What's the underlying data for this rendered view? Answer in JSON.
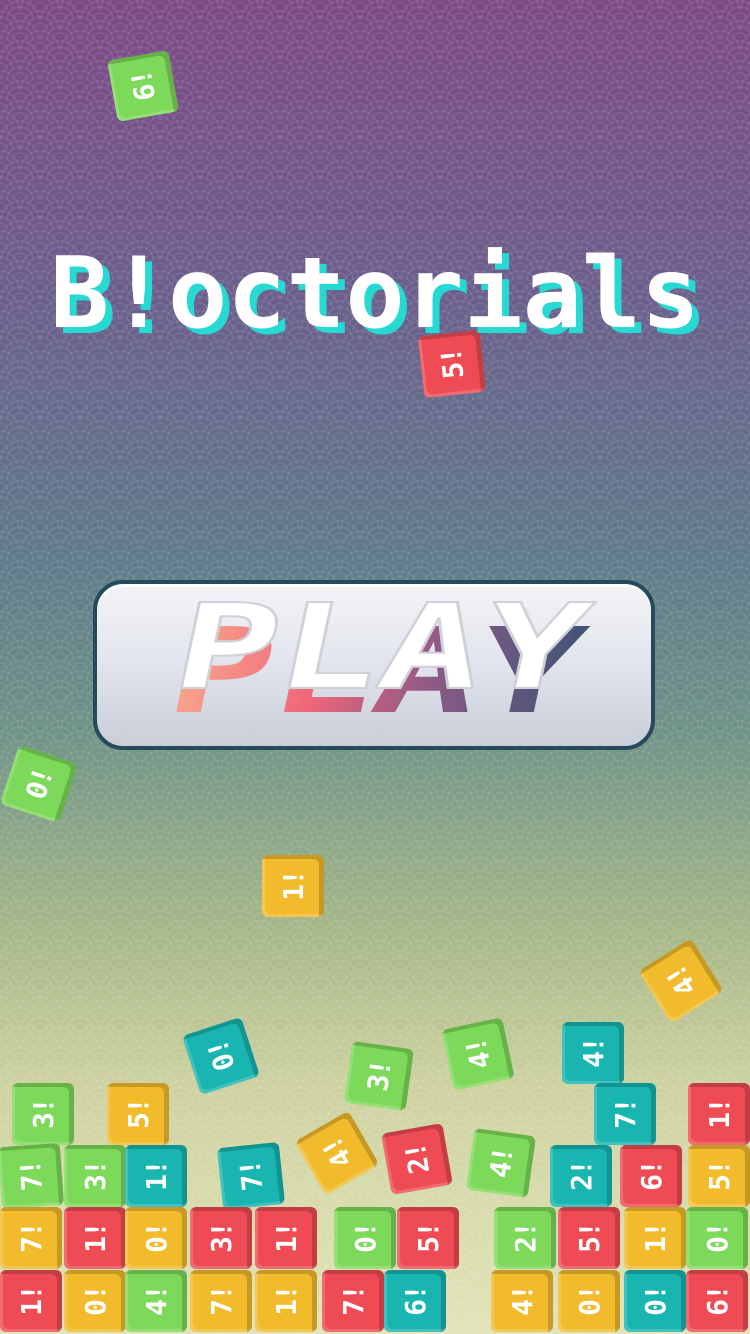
{
  "game": {
    "title": "B!octorials",
    "play_label": "PLAY"
  },
  "colors": {
    "green": "#7dd95a",
    "yellow": "#f1bb2c",
    "red": "#ee4b55",
    "teal": "#19b5b0",
    "title_fill": "#ffffff",
    "title_shadow": "#27d9d3",
    "button_border": "#244a5c"
  },
  "tiles": [
    {
      "label": "6!",
      "color": "green"
    },
    {
      "label": "5!",
      "color": "red"
    },
    {
      "label": "0!",
      "color": "green"
    },
    {
      "label": "1!",
      "color": "yellow"
    },
    {
      "label": "4!",
      "color": "yellow"
    },
    {
      "label": "0!",
      "color": "teal"
    },
    {
      "label": "3!",
      "color": "green"
    },
    {
      "label": "4!",
      "color": "green"
    },
    {
      "label": "4!",
      "color": "teal"
    },
    {
      "label": "3!",
      "color": "green"
    },
    {
      "label": "5!",
      "color": "yellow"
    },
    {
      "label": "7!",
      "color": "teal"
    },
    {
      "label": "1!",
      "color": "red"
    },
    {
      "label": "7!",
      "color": "green"
    },
    {
      "label": "3!",
      "color": "green"
    },
    {
      "label": "1!",
      "color": "teal"
    },
    {
      "label": "7!",
      "color": "teal"
    },
    {
      "label": "4!",
      "color": "yellow"
    },
    {
      "label": "2!",
      "color": "red"
    },
    {
      "label": "4!",
      "color": "green"
    },
    {
      "label": "2!",
      "color": "teal"
    },
    {
      "label": "6!",
      "color": "red"
    },
    {
      "label": "5!",
      "color": "yellow"
    },
    {
      "label": "7!",
      "color": "yellow"
    },
    {
      "label": "1!",
      "color": "red"
    },
    {
      "label": "0!",
      "color": "yellow"
    },
    {
      "label": "3!",
      "color": "red"
    },
    {
      "label": "1!",
      "color": "red"
    },
    {
      "label": "0!",
      "color": "green"
    },
    {
      "label": "5!",
      "color": "red"
    },
    {
      "label": "2!",
      "color": "green"
    },
    {
      "label": "5!",
      "color": "red"
    },
    {
      "label": "1!",
      "color": "yellow"
    },
    {
      "label": "0!",
      "color": "green"
    },
    {
      "label": "1!",
      "color": "red"
    },
    {
      "label": "0!",
      "color": "yellow"
    },
    {
      "label": "4!",
      "color": "green"
    },
    {
      "label": "7!",
      "color": "yellow"
    },
    {
      "label": "1!",
      "color": "yellow"
    },
    {
      "label": "7!",
      "color": "red"
    },
    {
      "label": "6!",
      "color": "teal"
    },
    {
      "label": "4!",
      "color": "yellow"
    },
    {
      "label": "0!",
      "color": "yellow"
    },
    {
      "label": "0!",
      "color": "teal"
    },
    {
      "label": "6!",
      "color": "red"
    }
  ]
}
